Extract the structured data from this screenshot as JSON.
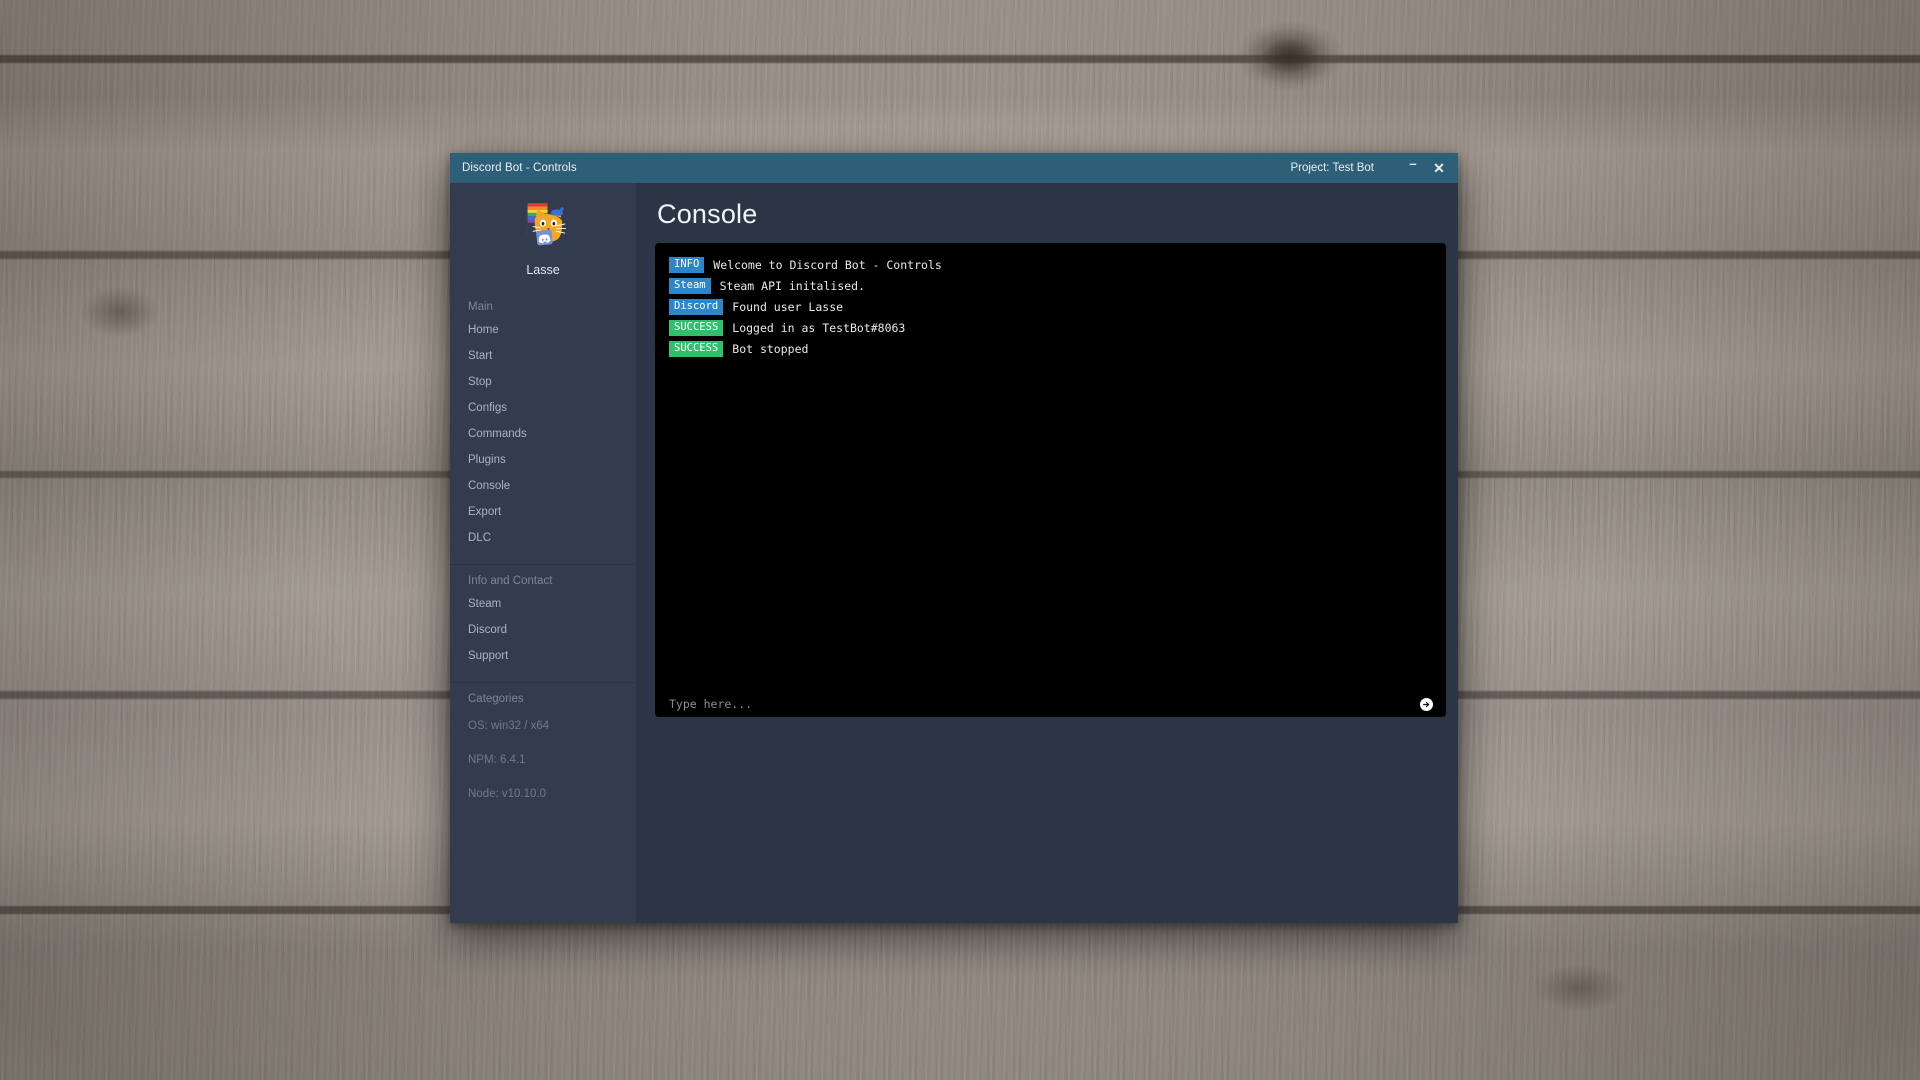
{
  "window": {
    "app_title": "Discord Bot - Controls",
    "project_label": "Project: Test Bot",
    "minimize_glyph": "–",
    "close_glyph": "✕"
  },
  "sidebar": {
    "profile": {
      "username": "Lasse",
      "avatar_icon": "cat-pride-flag-discord-avatar"
    },
    "sections": [
      {
        "title": "Main",
        "items": [
          {
            "label": "Home"
          },
          {
            "label": "Start"
          },
          {
            "label": "Stop"
          },
          {
            "label": "Configs"
          },
          {
            "label": "Commands"
          },
          {
            "label": "Plugins"
          },
          {
            "label": "Console"
          },
          {
            "label": "Export"
          },
          {
            "label": "DLC"
          }
        ]
      },
      {
        "title": "Info and Contact",
        "items": [
          {
            "label": "Steam"
          },
          {
            "label": "Discord"
          },
          {
            "label": "Support"
          }
        ]
      }
    ],
    "categories": {
      "title": "Categories",
      "items": [
        {
          "label": "OS: win32 / x64"
        },
        {
          "label": "NPM: 6.4.1"
        },
        {
          "label": "Node: v10.10.0"
        }
      ]
    }
  },
  "main": {
    "page_title": "Console",
    "console": {
      "lines": [
        {
          "badge": "INFO",
          "type": "info",
          "text": "Welcome to Discord Bot - Controls"
        },
        {
          "badge": "Steam",
          "type": "steam",
          "text": "Steam API initalised."
        },
        {
          "badge": "Discord",
          "type": "discord",
          "text": "Found user Lasse"
        },
        {
          "badge": "SUCCESS",
          "type": "success",
          "text": "Logged in as TestBot#8063"
        },
        {
          "badge": "SUCCESS",
          "type": "success",
          "text": "Bot stopped"
        }
      ],
      "input_value": "",
      "input_placeholder": "Type here...",
      "send_icon": "send-arrow-circle-icon"
    }
  },
  "colors": {
    "titlebar": "#2d6078",
    "sidebar": "#323c4e",
    "main_bg": "#2b3545",
    "badge_blue": "#2e86c8",
    "badge_green": "#2fbf6d",
    "console_bg": "#000000"
  }
}
